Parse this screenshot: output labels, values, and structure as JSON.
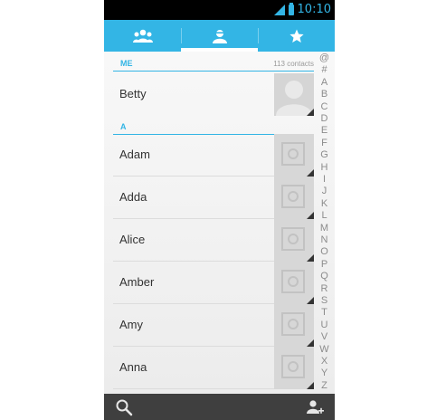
{
  "status_bar": {
    "time": "10:10"
  },
  "tabs": [
    {
      "icon": "groups-icon"
    },
    {
      "icon": "person-icon",
      "selected": true
    },
    {
      "icon": "star-icon"
    }
  ],
  "section_me": {
    "label": "ME",
    "contacts_count": "113 contacts"
  },
  "me_contact": {
    "name": "Betty",
    "avatar_icon": "default-avatar-icon"
  },
  "section_a": {
    "label": "A"
  },
  "contacts": [
    {
      "name": "Adam"
    },
    {
      "name": "Adda"
    },
    {
      "name": "Alice"
    },
    {
      "name": "Amber"
    },
    {
      "name": "Amy"
    },
    {
      "name": "Anna"
    }
  ],
  "alpha_index": [
    "@",
    "#",
    "A",
    "B",
    "C",
    "D",
    "E",
    "F",
    "G",
    "H",
    "I",
    "J",
    "K",
    "L",
    "M",
    "N",
    "O",
    "P",
    "Q",
    "R",
    "S",
    "T",
    "U",
    "V",
    "W",
    "X",
    "Y",
    "Z"
  ],
  "bottom_bar": {
    "left_icon": "search-icon",
    "right_icon": "add-contact-icon"
  },
  "colors": {
    "accent": "#33b5e5",
    "bottom_bar": "#3f3f3f"
  }
}
